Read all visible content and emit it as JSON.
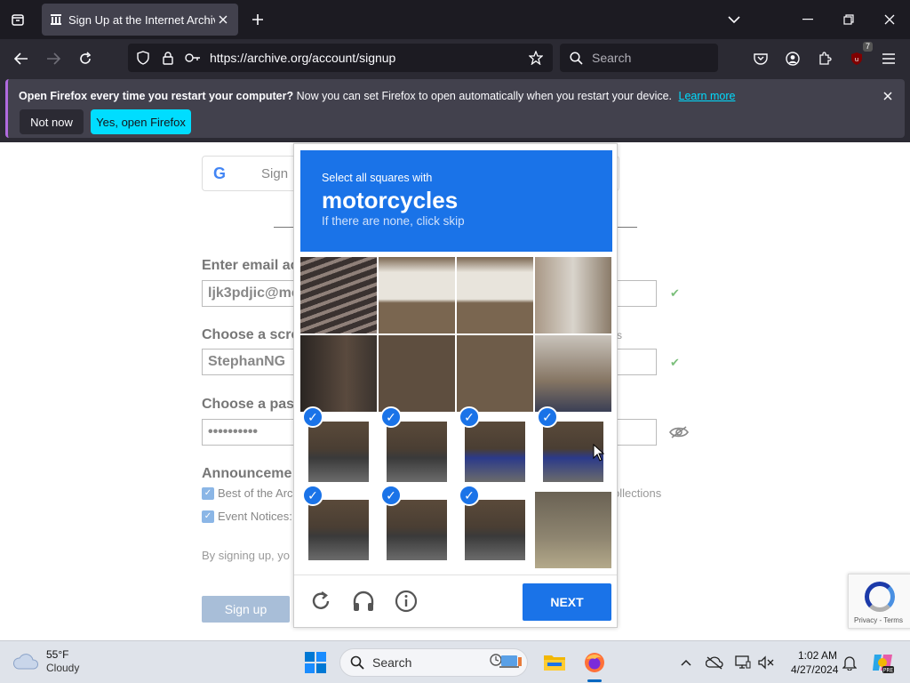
{
  "browser": {
    "tab_title": "Sign Up at the Internet Archive",
    "url": "https://archive.org/account/signup",
    "search_placeholder": "Search",
    "extension_badge": "7"
  },
  "notification": {
    "bold": "Open Firefox every time you restart your computer?",
    "text": " Now you can set Firefox to open automatically when you restart your device.",
    "learn_more": "Learn more",
    "not_now": "Not now",
    "yes_open": "Yes, open Firefox"
  },
  "page": {
    "google_label": "Sign",
    "email_label": "Enter email ac",
    "email_value": "ljk3pdjic@mo",
    "screen_label": "Choose a scre",
    "screen_value": "StephanNG",
    "screen_hint": "rs",
    "pass_label": "Choose a pas",
    "pass_value": "••••••••••",
    "announce_label": "Announceme",
    "cb1_label": "Best of the Arc",
    "cb2_label": "Event Notices:",
    "collections_text": "ollections",
    "terms_text": "By signing up, yo",
    "signup_button": "Sign up",
    "recaptcha_text": "Privacy - Terms"
  },
  "captcha": {
    "instruction": "Select all squares with",
    "target": "motorcycles",
    "hint": "If there are none, click skip",
    "next_button": "NEXT",
    "tiles": [
      {
        "selected": false
      },
      {
        "selected": false
      },
      {
        "selected": false
      },
      {
        "selected": false
      },
      {
        "selected": false
      },
      {
        "selected": false
      },
      {
        "selected": false
      },
      {
        "selected": false
      },
      {
        "selected": true
      },
      {
        "selected": true
      },
      {
        "selected": true
      },
      {
        "selected": true
      },
      {
        "selected": true
      },
      {
        "selected": true
      },
      {
        "selected": true
      },
      {
        "selected": false
      }
    ]
  },
  "taskbar": {
    "temp": "55°F",
    "condition": "Cloudy",
    "search": "Search",
    "time": "1:02 AM",
    "date": "4/27/2024"
  }
}
